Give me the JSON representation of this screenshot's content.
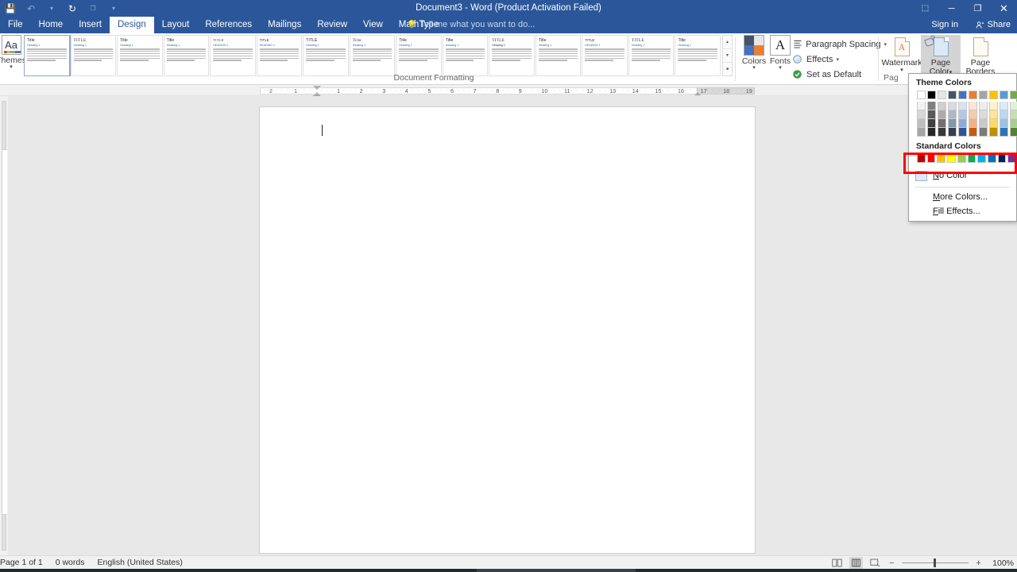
{
  "window": {
    "title": "Document3 - Word (Product Activation Failed)",
    "quick_access": [
      {
        "name": "save-icon",
        "glyph": "💾"
      },
      {
        "name": "undo-icon",
        "glyph": "↶"
      },
      {
        "name": "undo-dropdown-icon",
        "glyph": "▾"
      },
      {
        "name": "redo-icon",
        "glyph": "↻"
      },
      {
        "name": "repeat-icon",
        "glyph": "❐"
      },
      {
        "name": "customize-qat-icon",
        "glyph": "▾"
      }
    ],
    "controls": {
      "ribbon_display": "⬚",
      "minimize": "─",
      "restore": "❐",
      "close": "✕"
    },
    "sign_in": "Sign in",
    "share": "Share"
  },
  "tabs": [
    {
      "label": "File",
      "active": false
    },
    {
      "label": "Home",
      "active": false
    },
    {
      "label": "Insert",
      "active": false
    },
    {
      "label": "Design",
      "active": true
    },
    {
      "label": "Layout",
      "active": false
    },
    {
      "label": "References",
      "active": false
    },
    {
      "label": "Mailings",
      "active": false
    },
    {
      "label": "Review",
      "active": false
    },
    {
      "label": "View",
      "active": false
    },
    {
      "label": "MathType",
      "active": false
    }
  ],
  "tell_me": {
    "placeholder": "Tell me what you want to do...",
    "icon": "💡"
  },
  "ribbon": {
    "themes": {
      "label": "Themes",
      "caret": "▾",
      "icon_letters": "Aa"
    },
    "document_formatting_label": "Document Formatting",
    "gallery": {
      "scroll_up": "▲",
      "scroll_more": "▼",
      "thumbnails": [
        {
          "title": "Title",
          "heading": "Heading 1",
          "selected": true
        },
        {
          "title": "TITLE",
          "heading": "Heading 1",
          "selected": false
        },
        {
          "title": "Title",
          "heading": "Heading 1",
          "selected": false
        },
        {
          "title": "Title",
          "heading": "Heading 1",
          "selected": false
        },
        {
          "title": "TITLE",
          "heading": "HEADING 1",
          "selected": false
        },
        {
          "title": "TITLE",
          "heading": "HEADING 1",
          "selected": false
        },
        {
          "title": "TITLE",
          "heading": "Heading 1",
          "selected": false
        },
        {
          "title": "Title",
          "heading": "Heading 1",
          "selected": false
        },
        {
          "title": "Title",
          "heading": "Heading 1",
          "selected": false
        },
        {
          "title": "Title",
          "heading": "Heading 1",
          "selected": false
        },
        {
          "title": "TITLE",
          "heading": "Heading 1",
          "selected": false
        },
        {
          "title": "Title",
          "heading": "Heading 1",
          "selected": false
        },
        {
          "title": "TITLE",
          "heading": "HEADING 1",
          "selected": false
        },
        {
          "title": "TITLE",
          "heading": "Heading 1",
          "selected": false
        },
        {
          "title": "Title",
          "heading": "Heading 1",
          "selected": false
        }
      ]
    },
    "colors": {
      "label": "Colors",
      "caret": "▾"
    },
    "fonts": {
      "label": "Fonts",
      "caret": "▾",
      "glyph": "A"
    },
    "paragraph_spacing": {
      "label": "Paragraph Spacing",
      "caret": "▾"
    },
    "effects": {
      "label": "Effects",
      "caret": "▾"
    },
    "set_as_default": {
      "label": "Set as Default"
    },
    "watermark": {
      "label": "Watermark",
      "caret": "▾"
    },
    "page_color": {
      "label_line1": "Page",
      "label_line2": "Color",
      "caret": "▾",
      "active": true
    },
    "page_borders": {
      "label_line1": "Page",
      "label_line2": "Borders"
    },
    "page_background_label": "Pag"
  },
  "ruler": {
    "marks_left": [
      "2",
      "1"
    ],
    "marks_right": [
      "1",
      "2",
      "3",
      "4",
      "5",
      "6",
      "7",
      "8",
      "9",
      "10",
      "11",
      "12",
      "13",
      "14",
      "15",
      "16",
      "17",
      "18",
      "19"
    ]
  },
  "page_color_menu": {
    "theme_colors_label": "Theme Colors",
    "standard_colors_label": "Standard Colors",
    "theme_columns": [
      [
        "#ffffff",
        "#f2f2f2",
        "#d8d8d8",
        "#bfbfbf",
        "#a5a5a5"
      ],
      [
        "#000000",
        "#7f7f7f",
        "#595959",
        "#3f3f3f",
        "#262626"
      ],
      [
        "#e7e6e6",
        "#d0cece",
        "#aeaaaa",
        "#757070",
        "#3b3838"
      ],
      [
        "#44546a",
        "#d5dce4",
        "#adb9ca",
        "#8496b0",
        "#323f4f"
      ],
      [
        "#4472c4",
        "#d9e2f3",
        "#b4c6e7",
        "#8eaadb",
        "#2f5496"
      ],
      [
        "#ed7d31",
        "#fbe5d5",
        "#f7caac",
        "#f4b083",
        "#c55a11"
      ],
      [
        "#a5a5a5",
        "#ededed",
        "#dbdbdb",
        "#c9c9c9",
        "#7b7b7b"
      ],
      [
        "#ffc000",
        "#fff2cc",
        "#ffe599",
        "#ffd966",
        "#bf9000"
      ],
      [
        "#5b9bd5",
        "#deeaf6",
        "#bdd7ee",
        "#9cc3e5",
        "#2e75b5"
      ],
      [
        "#70ad47",
        "#e2efd9",
        "#c5e0b3",
        "#a8d08d",
        "#538135"
      ]
    ],
    "standard_colors": [
      "#c00000",
      "#ff0000",
      "#ffc000",
      "#ffff00",
      "#92d050",
      "#00b050",
      "#00b0f0",
      "#0070c0",
      "#002060",
      "#7030a0"
    ],
    "items": [
      {
        "label": "No Color",
        "accel": "N",
        "swatch": "#dfeaf6",
        "highlighted": true
      },
      {
        "label": "More Colors...",
        "accel": "M",
        "highlighted": false
      },
      {
        "label": "Fill Effects...",
        "accel": "F",
        "highlighted": false
      }
    ],
    "highlight_color": "#ff0000"
  },
  "status_bar": {
    "page": "Page 1 of 1",
    "words": "0 words",
    "language": "English (United States)",
    "views": [
      {
        "name": "read-mode-icon",
        "active": false
      },
      {
        "name": "print-layout-icon",
        "active": true
      },
      {
        "name": "web-layout-icon",
        "active": false
      }
    ],
    "zoom": {
      "minus": "−",
      "plus": "+",
      "percent": "100%",
      "value": 100
    }
  }
}
